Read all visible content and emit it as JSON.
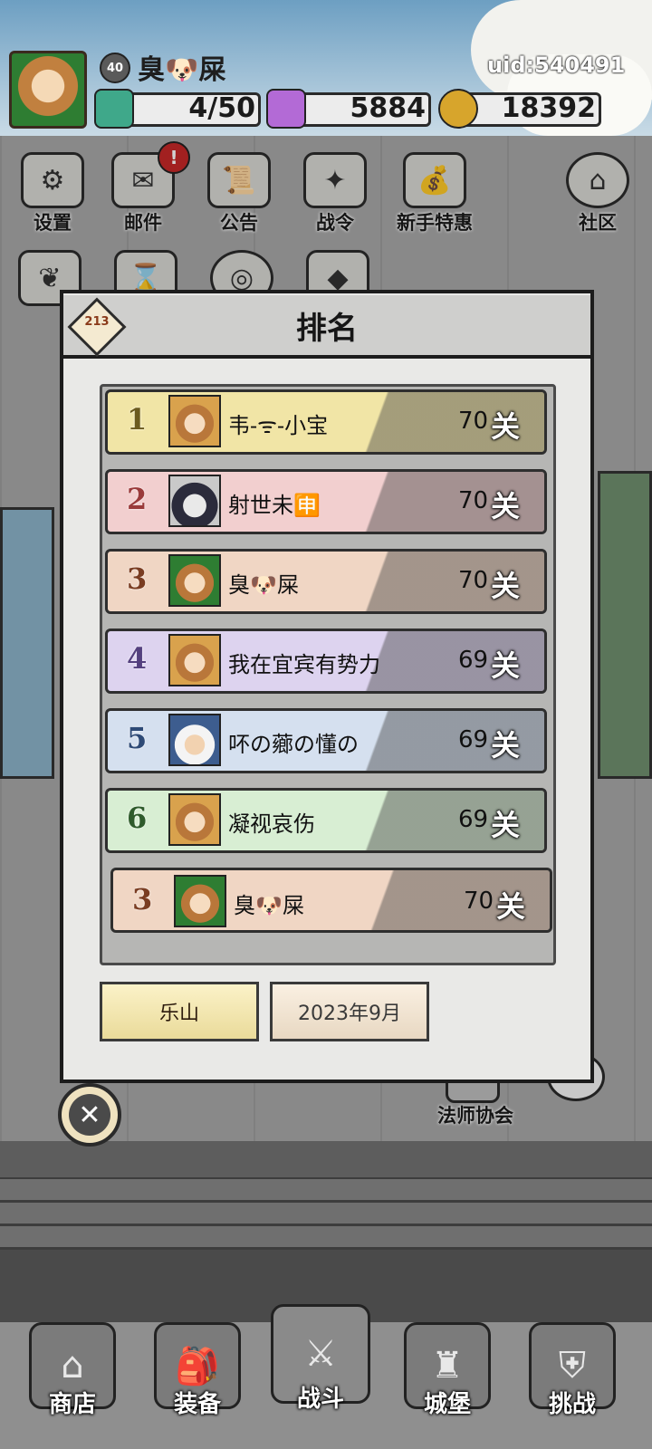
{
  "header": {
    "level": "40",
    "player_name": "臭🐶屎",
    "uid": "uid:540491",
    "resources": [
      {
        "icon": "green-gem-icon",
        "value": "4/50"
      },
      {
        "icon": "purple-diamond-icon",
        "value": "5884"
      },
      {
        "icon": "gold-coin-icon",
        "value": "18392"
      }
    ]
  },
  "top_menu": [
    {
      "label": "设置",
      "icon": "gear-icon"
    },
    {
      "label": "邮件",
      "icon": "mail-icon",
      "badge": "!"
    },
    {
      "label": "公告",
      "icon": "scroll-icon"
    },
    {
      "label": "战令",
      "icon": "compass-icon"
    },
    {
      "label": "新手特惠",
      "icon": "bag-icon"
    },
    {
      "label": "社区",
      "icon": "home-icon"
    }
  ],
  "modal": {
    "title": "排名",
    "rank_icon_text": "213",
    "rows": [
      {
        "rank": "1",
        "name": "韦-ᯤ-小宝",
        "score": "70",
        "unit": "关",
        "color": "#f1e5a6",
        "rank_color": "#6b5a1e"
      },
      {
        "rank": "2",
        "name": "射世未🈸",
        "score": "70",
        "unit": "关",
        "color": "#f2cfcf",
        "rank_color": "#9a3b3b"
      },
      {
        "rank": "3",
        "name": "臭🐶屎",
        "score": "70",
        "unit": "关",
        "color": "#f0d6c4",
        "rank_color": "#7a3d22"
      },
      {
        "rank": "4",
        "name": "我在宜宾有势力",
        "score": "69",
        "unit": "关",
        "color": "#ddd3ef",
        "rank_color": "#54407e"
      },
      {
        "rank": "5",
        "name": "吥の薌の懂の",
        "score": "69",
        "unit": "关",
        "color": "#d5e0ef",
        "rank_color": "#2e4a76"
      },
      {
        "rank": "6",
        "name": "凝视哀伤",
        "score": "69",
        "unit": "关",
        "color": "#d8eed3",
        "rank_color": "#2f5b2c"
      }
    ],
    "self_row": {
      "rank": "3",
      "name": "臭🐶屎",
      "score": "70",
      "unit": "关",
      "color": "#f0d6c4",
      "rank_color": "#7a3d22"
    },
    "tabs": [
      {
        "label": "乐山",
        "selected": true
      },
      {
        "label": "2023年9月",
        "selected": false
      }
    ]
  },
  "side": {
    "mage_guild_label": "法师协会"
  },
  "bottom_nav": [
    {
      "label": "商店",
      "icon": "shop-icon"
    },
    {
      "label": "装备",
      "icon": "backpack-icon"
    },
    {
      "label": "战斗",
      "icon": "crossed-swords-icon"
    },
    {
      "label": "城堡",
      "icon": "castle-icon"
    },
    {
      "label": "挑战",
      "icon": "shield-icon"
    }
  ]
}
